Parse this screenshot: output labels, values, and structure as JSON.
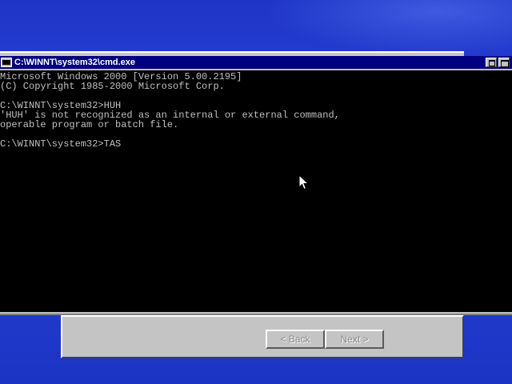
{
  "desktop": {
    "background_color": "#1f35c8"
  },
  "console": {
    "title": "C:\\WINNT\\system32\\cmd.exe",
    "titlebar_color": "#000080",
    "text_color": "#c0c0c0",
    "background_color": "#000000",
    "lines": [
      "Microsoft Windows 2000 [Version 5.00.2195]",
      "(C) Copyright 1985-2000 Microsoft Corp.",
      "",
      "C:\\WINNT\\system32>HUH",
      "'HUH' is not recognized as an internal or external command,",
      "operable program or batch file.",
      "",
      "C:\\WINNT\\system32>TAS"
    ]
  },
  "wizard": {
    "back_label": "< Back",
    "next_label": "Next >"
  },
  "icons": {
    "app": "console-app-icon",
    "restore": "restore-icon",
    "close": "close-icon",
    "cursor": "mouse-pointer-icon"
  }
}
